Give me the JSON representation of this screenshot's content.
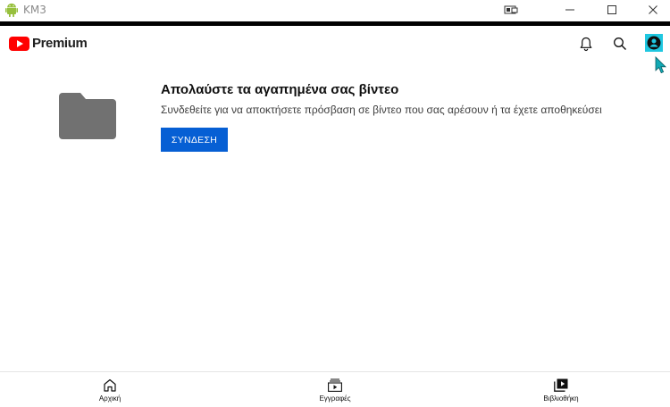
{
  "window": {
    "title": "KM3",
    "icons": [
      "android-icon",
      "device-mirror-icon",
      "minimize-icon",
      "maximize-icon",
      "close-icon"
    ]
  },
  "header": {
    "brand": "Premium",
    "icons": [
      "youtube-logo-icon",
      "bell-icon",
      "search-icon",
      "account-icon"
    ],
    "accent_color": "#ff0000"
  },
  "main": {
    "title": "Απολαύστε τα αγαπημένα σας βίντεο",
    "subtitle": "Συνδεθείτε για να αποκτήσετε πρόσβαση σε βίντεο που σας αρέσουν ή τα έχετε αποθηκεύσει",
    "signin_label": "ΣΥΝΔΕΣΗ",
    "signin_color": "#065fd4",
    "illustration_icon": "folder-icon"
  },
  "bottom_nav": {
    "items": [
      {
        "label": "Αρχική",
        "icon": "home-icon"
      },
      {
        "label": "Εγγραφές",
        "icon": "subscriptions-icon"
      },
      {
        "label": "Βιβλιοθήκη",
        "icon": "library-icon"
      }
    ]
  }
}
